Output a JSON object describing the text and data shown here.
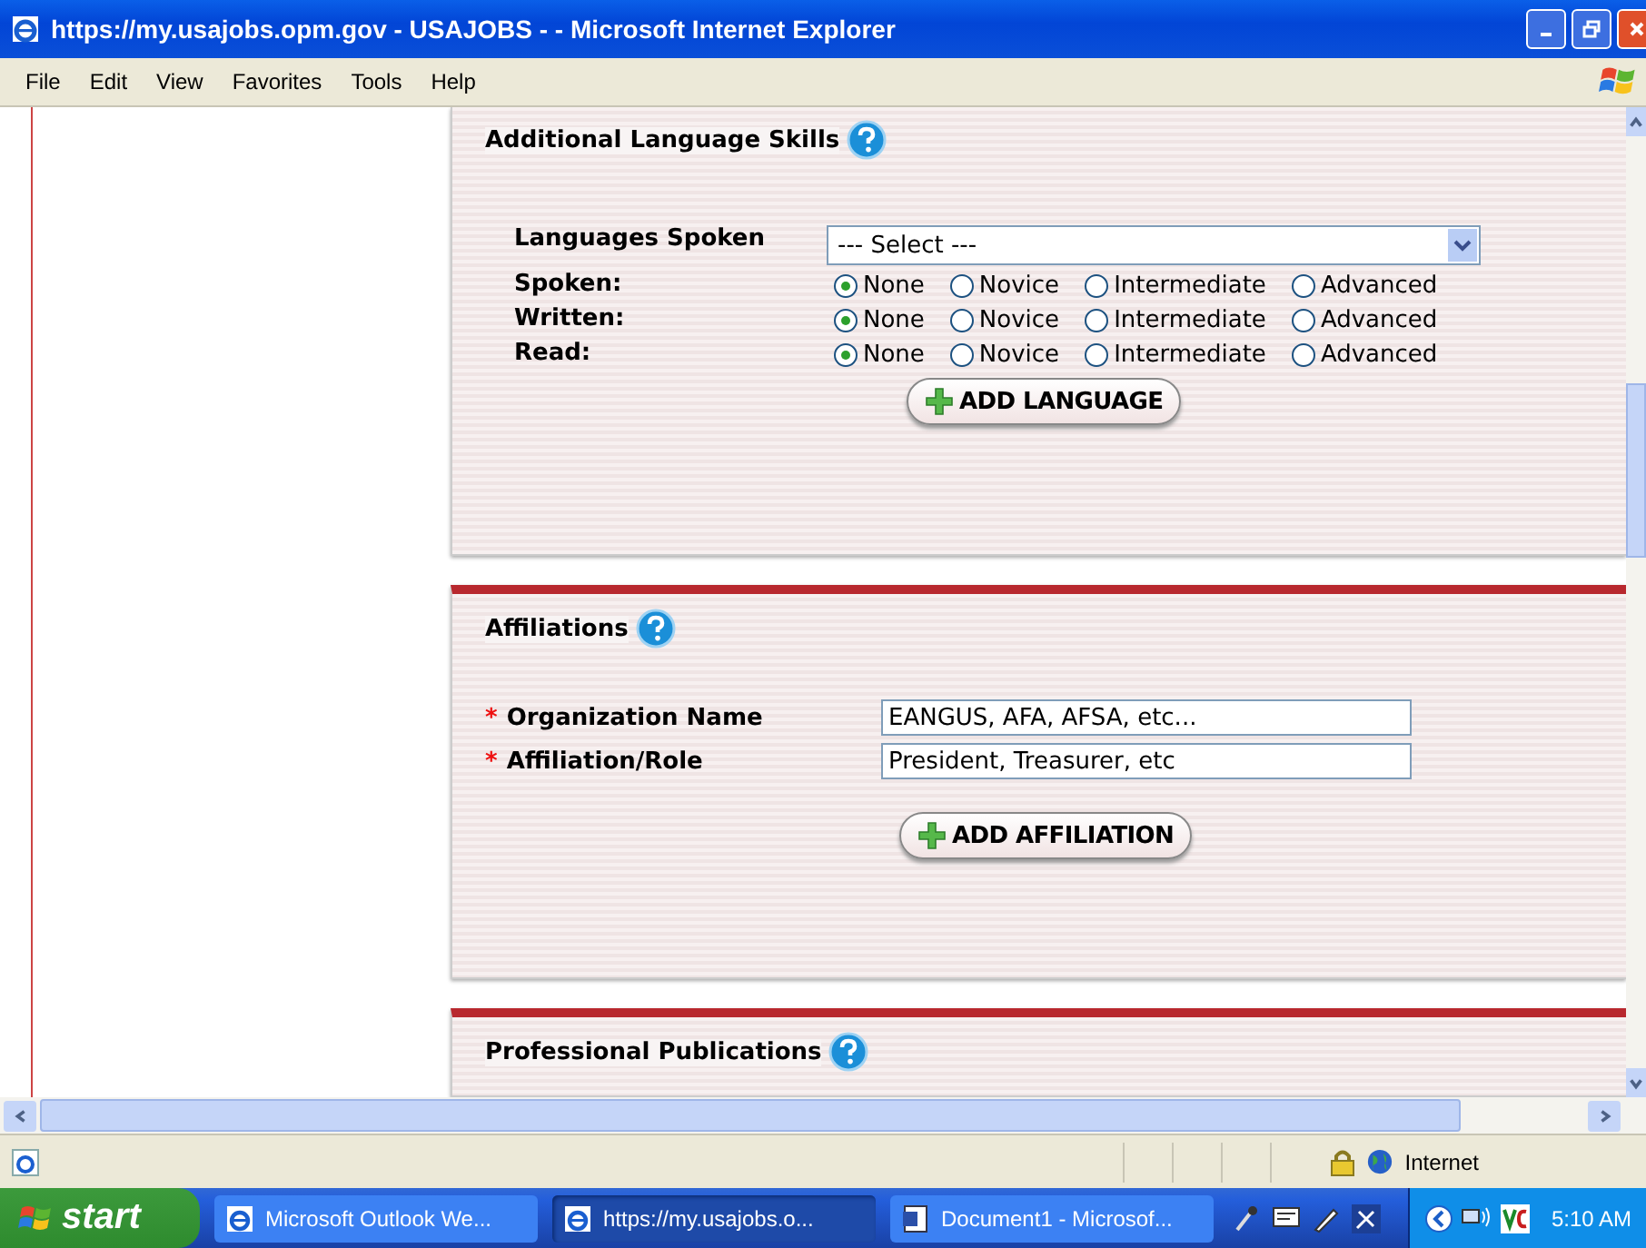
{
  "window": {
    "title": "https://my.usajobs.opm.gov - USAJOBS - - Microsoft Internet Explorer"
  },
  "menu": [
    "File",
    "Edit",
    "View",
    "Favorites",
    "Tools",
    "Help"
  ],
  "sections": [
    {
      "kind": "language",
      "title": "Additional Language Skills",
      "select_label": "Languages Spoken",
      "select_value": "--- Select ---",
      "ratings": [
        {
          "label": "Spoken:",
          "options": [
            {
              "label": "None",
              "selected": true
            },
            {
              "label": "Novice",
              "selected": false
            },
            {
              "label": "Intermediate",
              "selected": false
            },
            {
              "label": "Advanced",
              "selected": false
            }
          ]
        },
        {
          "label": "Written:",
          "options": [
            {
              "label": "None",
              "selected": true
            },
            {
              "label": "Novice",
              "selected": false
            },
            {
              "label": "Intermediate",
              "selected": false
            },
            {
              "label": "Advanced",
              "selected": false
            }
          ]
        },
        {
          "label": "Read:",
          "options": [
            {
              "label": "None",
              "selected": true
            },
            {
              "label": "Novice",
              "selected": false
            },
            {
              "label": "Intermediate",
              "selected": false
            },
            {
              "label": "Advanced",
              "selected": false
            }
          ]
        }
      ],
      "button": "ADD LANGUAGE"
    },
    {
      "kind": "affiliation",
      "title": "Affiliations",
      "fields": [
        {
          "label": "Organization Name",
          "required_mark": "*",
          "value": "EANGUS, AFA, AFSA, etc..."
        },
        {
          "label": "Affiliation/Role",
          "required_mark": "*",
          "value": "President, Treasurer, etc"
        }
      ],
      "button": "ADD AFFILIATION"
    },
    {
      "kind": "header",
      "title": "Professional Publications"
    }
  ],
  "status_bar": {
    "zone": "Internet"
  },
  "taskbar": {
    "start": "start",
    "tasks": [
      {
        "label": "Microsoft Outlook We...",
        "selected": false
      },
      {
        "label": "https://my.usajobs.o...",
        "selected": true
      },
      {
        "label": "Document1 - Microsof...",
        "selected": false
      }
    ],
    "clock": "5:10 AM"
  }
}
